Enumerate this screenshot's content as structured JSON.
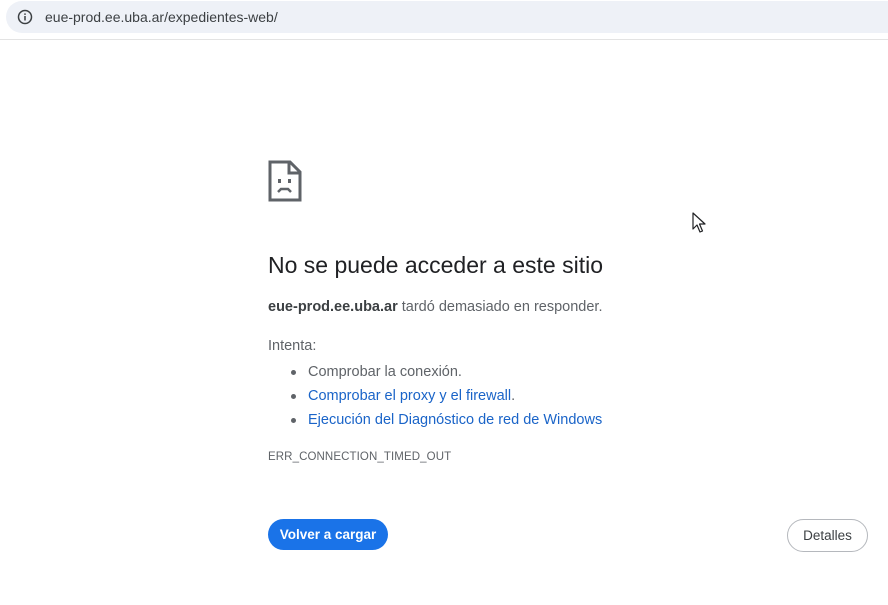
{
  "address_bar": {
    "url": "eue-prod.ee.uba.ar/expedientes-web/",
    "info_icon": "info-circle-icon"
  },
  "error_page": {
    "icon": "sad-document-icon",
    "title": "No se puede acceder a este sitio",
    "host": "eue-prod.ee.uba.ar",
    "message_suffix": " tardó demasiado en responder.",
    "try_label": "Intenta:",
    "suggestions": [
      {
        "text": "Comprobar la conexión.",
        "link": false
      },
      {
        "text": "Comprobar el proxy y el firewall",
        "link": true,
        "suffix": "."
      },
      {
        "text": "Ejecución del Diagnóstico de red de Windows",
        "link": true,
        "suffix": ""
      }
    ],
    "error_code": "ERR_CONNECTION_TIMED_OUT",
    "reload_label": "Volver a cargar",
    "details_label": "Detalles"
  },
  "colors": {
    "accent": "#1a73e8",
    "link": "#1a64c8",
    "text_primary": "#202124",
    "text_secondary": "#5f6368"
  }
}
